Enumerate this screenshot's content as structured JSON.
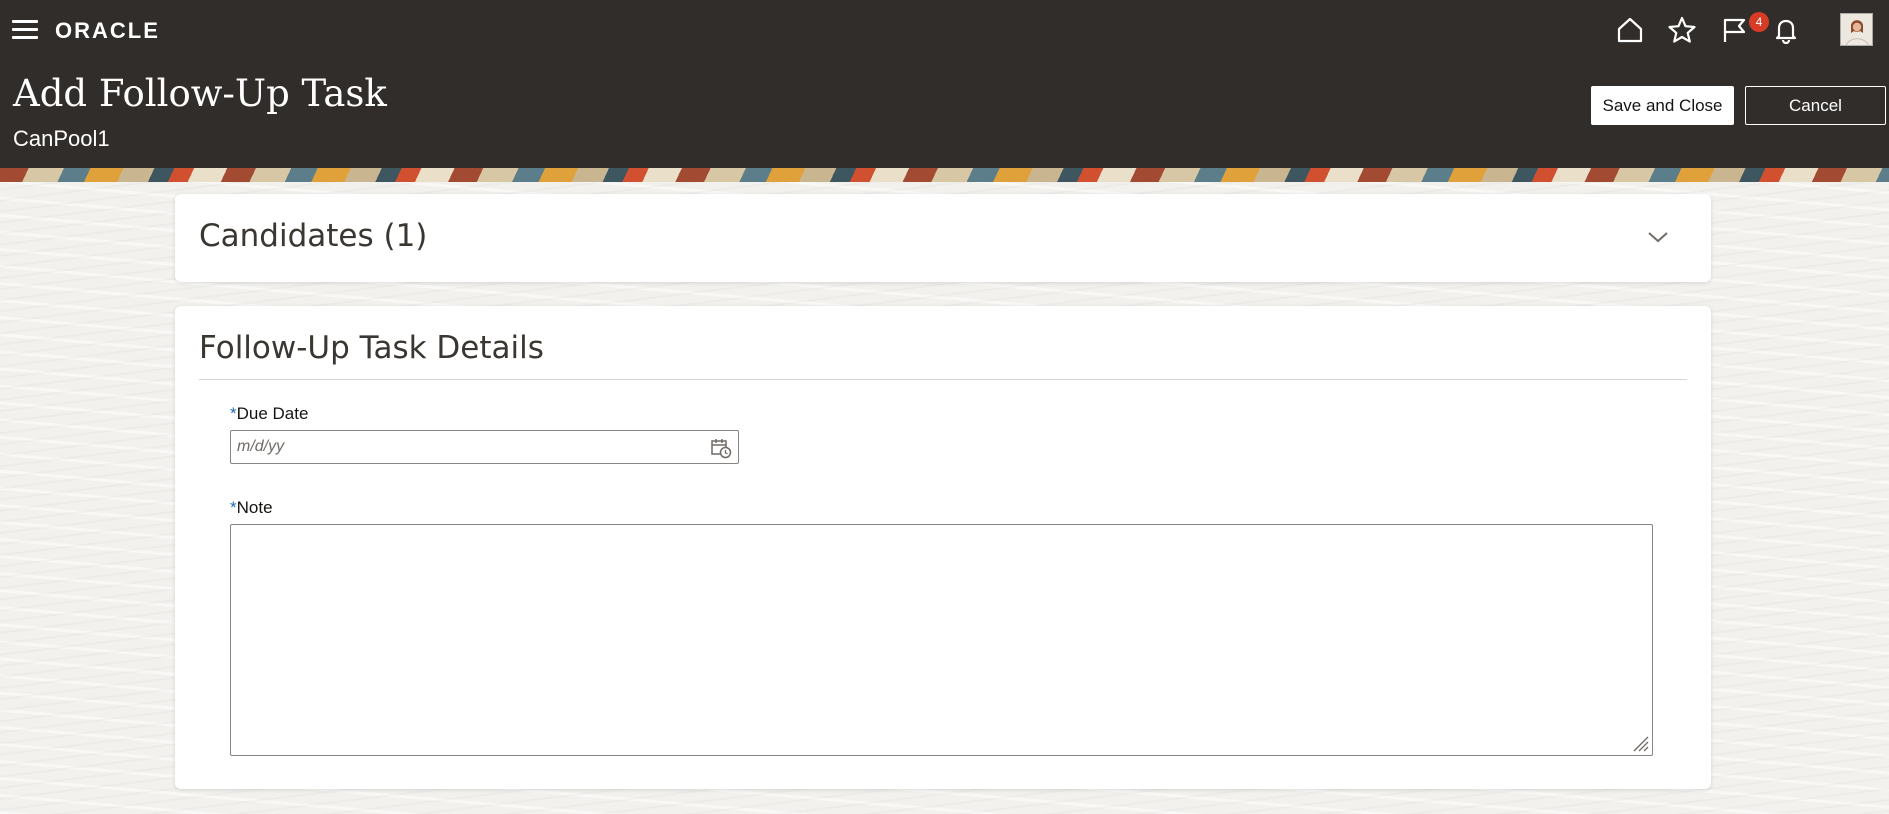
{
  "header": {
    "logo": "ORACLE",
    "title": "Add Follow-Up Task",
    "subtitle": "CanPool1",
    "notification_count": "4",
    "save_label": "Save and Close",
    "cancel_label": "Cancel",
    "icons": [
      "menu-icon",
      "home-icon",
      "favorites-star-icon",
      "flag-icon",
      "bell-icon",
      "user-avatar"
    ]
  },
  "candidates_section": {
    "title": "Candidates (1)"
  },
  "details_section": {
    "title": "Follow-Up Task Details",
    "due_date": {
      "required_marker": "*",
      "label": "Due Date",
      "value": "",
      "placeholder": "m/d/yy"
    },
    "note": {
      "required_marker": "*",
      "label": "Note",
      "value": ""
    }
  },
  "colors": {
    "header_bg": "#312d2a",
    "badge": "#d63b25",
    "required": "#1e6db3"
  }
}
